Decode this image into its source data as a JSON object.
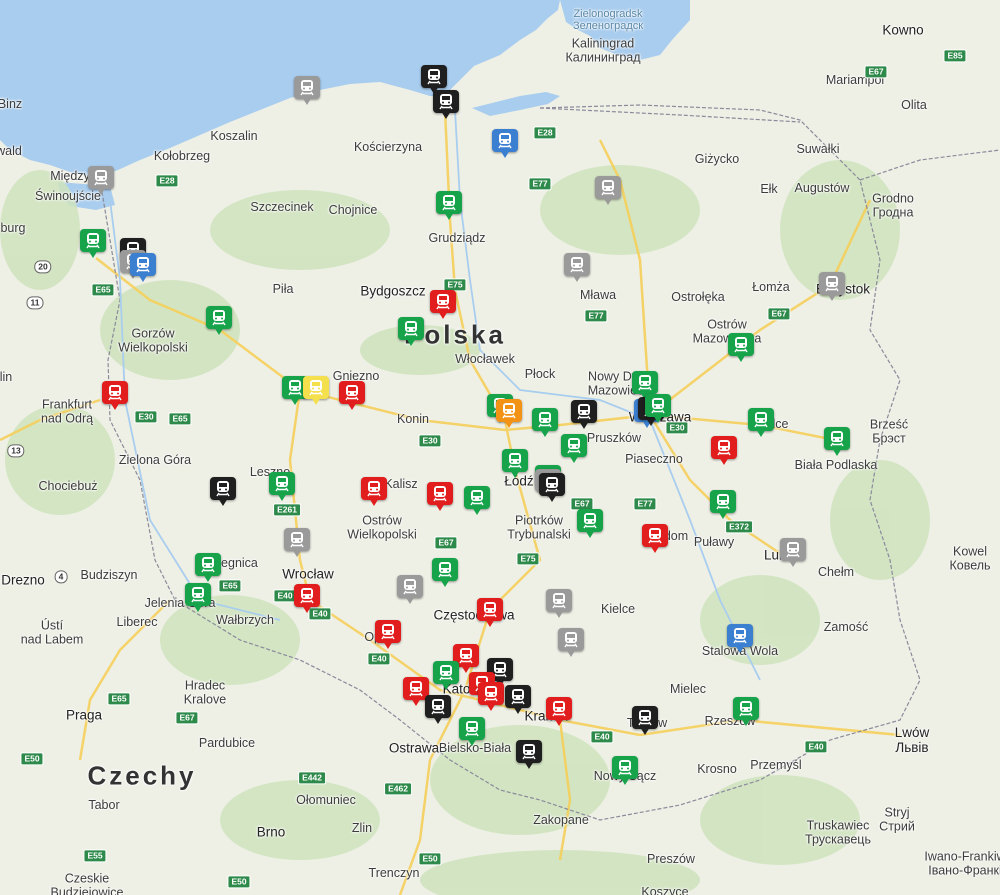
{
  "map": {
    "colors": {
      "land": "#eef0e6",
      "water": "#a9cdee",
      "green": "#cfe3bd",
      "forest": "#bcd9a3",
      "road_major": "#f6cf5a",
      "border": "#8a8a9a"
    },
    "labels": [
      {
        "id": "bornholm-strip",
        "text": "Binz",
        "cls": "city"
      },
      {
        "id": "kowno",
        "text": "Kowno",
        "cls": "big"
      },
      {
        "id": "zelenogradsk",
        "text": "Zielonogradsk\nЗеленоградск",
        "cls": "sea"
      },
      {
        "id": "kaliningrad",
        "text": "Kaliningrad\nКалининград",
        "cls": "city"
      },
      {
        "id": "marijampol",
        "text": "Mariampol",
        "cls": "city"
      },
      {
        "id": "olita",
        "text": "Olita",
        "cls": "city"
      },
      {
        "id": "koszalin",
        "text": "Koszalin",
        "cls": "city"
      },
      {
        "id": "kolobrzeg",
        "text": "Kołobrzeg",
        "cls": "city"
      },
      {
        "id": "koscierzyna",
        "text": "Kościerzyna",
        "cls": "city"
      },
      {
        "id": "gizycko",
        "text": "Giżycko",
        "cls": "city"
      },
      {
        "id": "suwalki",
        "text": "Suwałki",
        "cls": "city"
      },
      {
        "id": "augustow",
        "text": "Augustów",
        "cls": "city"
      },
      {
        "id": "elk",
        "text": "Ełk",
        "cls": "city"
      },
      {
        "id": "grodno",
        "text": "Grodno\nГродна",
        "cls": "city"
      },
      {
        "id": "szczecinek",
        "text": "Szczecinek",
        "cls": "city"
      },
      {
        "id": "chojnice",
        "text": "Chojnice",
        "cls": "city"
      },
      {
        "id": "grudziadz",
        "text": "Grudziądz",
        "cls": "city"
      },
      {
        "id": "wald",
        "text": "wald",
        "cls": "city"
      },
      {
        "id": "burg",
        "text": "burg",
        "cls": "city"
      },
      {
        "id": "swinoujscie",
        "text": "Świnoujście",
        "cls": "city"
      },
      {
        "id": "miedzy",
        "text": "Między",
        "cls": "city"
      },
      {
        "id": "pila",
        "text": "Piła",
        "cls": "city"
      },
      {
        "id": "bydgoszcz",
        "text": "Bydgoszcz",
        "cls": "big"
      },
      {
        "id": "mlawa",
        "text": "Mława",
        "cls": "city"
      },
      {
        "id": "ostroleka",
        "text": "Ostrołęka",
        "cls": "city"
      },
      {
        "id": "lomza",
        "text": "Łomża",
        "cls": "city"
      },
      {
        "id": "bialystok",
        "text": "Białystok",
        "cls": "big"
      },
      {
        "id": "polska",
        "text": "Polska",
        "cls": "country"
      },
      {
        "id": "gorzow",
        "text": "Gorzów\nWielkopolski",
        "cls": "city"
      },
      {
        "id": "wloclawek",
        "text": "Włocławek",
        "cls": "city"
      },
      {
        "id": "ostrow-maz",
        "text": "Ostrów\nMazowiecka",
        "cls": "city"
      },
      {
        "id": "lin",
        "text": "lin",
        "cls": "city"
      },
      {
        "id": "gniezno",
        "text": "Gniezno",
        "cls": "city"
      },
      {
        "id": "plock",
        "text": "Płock",
        "cls": "city"
      },
      {
        "id": "nowy-dwor",
        "text": "Nowy Dwór\nMazowiecki",
        "cls": "city"
      },
      {
        "id": "frankfurt",
        "text": "Frankfurt\nnad Odrą",
        "cls": "city"
      },
      {
        "id": "konin",
        "text": "Konin",
        "cls": "city"
      },
      {
        "id": "warszawa",
        "text": "Warszawa",
        "cls": "big"
      },
      {
        "id": "brzesc",
        "text": "Brześć\nБрэст",
        "cls": "city"
      },
      {
        "id": "pruszkow",
        "text": "Pruszków",
        "cls": "city"
      },
      {
        "id": "siedlce",
        "text": "Siedlce",
        "cls": "city"
      },
      {
        "id": "piaseczno",
        "text": "Piaseczno",
        "cls": "city"
      },
      {
        "id": "biala-podlaska",
        "text": "Biała Podlaska",
        "cls": "city"
      },
      {
        "id": "zielona-gora",
        "text": "Zielona Góra",
        "cls": "city"
      },
      {
        "id": "lodz",
        "text": "Łódź",
        "cls": "big"
      },
      {
        "id": "leszno",
        "text": "Leszno",
        "cls": "city"
      },
      {
        "id": "chociebuz",
        "text": "Chociebuż",
        "cls": "city"
      },
      {
        "id": "kalisz",
        "text": "Kalisz",
        "cls": "city"
      },
      {
        "id": "ostrow-wlkp",
        "text": "Ostrów\nWielkopolski",
        "cls": "city"
      },
      {
        "id": "piotrkow",
        "text": "Piotrków\nTrybunalski",
        "cls": "city"
      },
      {
        "id": "radom",
        "text": "Radom",
        "cls": "city"
      },
      {
        "id": "pulawy",
        "text": "Puławy",
        "cls": "city"
      },
      {
        "id": "lublin",
        "text": "Lublin",
        "cls": "big"
      },
      {
        "id": "kowel",
        "text": "Kowel\nКовель",
        "cls": "city"
      },
      {
        "id": "drezno",
        "text": "Drezno",
        "cls": "big"
      },
      {
        "id": "budziszyn",
        "text": "Budziszyn",
        "cls": "city"
      },
      {
        "id": "legnica",
        "text": "Legnica",
        "cls": "city"
      },
      {
        "id": "wroclaw",
        "text": "Wrocław",
        "cls": "big"
      },
      {
        "id": "chelm",
        "text": "Chełm",
        "cls": "city"
      },
      {
        "id": "jelenia",
        "text": "Jelenia Góra",
        "cls": "city"
      },
      {
        "id": "usti",
        "text": "Ústí\nnad Labem",
        "cls": "city"
      },
      {
        "id": "liberec",
        "text": "Liberec",
        "cls": "city"
      },
      {
        "id": "walbrzych",
        "text": "Wałbrzych",
        "cls": "city"
      },
      {
        "id": "opole",
        "text": "Opole",
        "cls": "city"
      },
      {
        "id": "czestochowa",
        "text": "Częstochowa",
        "cls": "big"
      },
      {
        "id": "kielce",
        "text": "Kielce",
        "cls": "city"
      },
      {
        "id": "zamosc",
        "text": "Zamość",
        "cls": "city"
      },
      {
        "id": "stalowa",
        "text": "Stalowa Wola",
        "cls": "city"
      },
      {
        "id": "hradec",
        "text": "Hradec\nKralove",
        "cls": "city"
      },
      {
        "id": "katowice",
        "text": "Katowice",
        "cls": "big"
      },
      {
        "id": "mielec",
        "text": "Mielec",
        "cls": "city"
      },
      {
        "id": "praga",
        "text": "Praga",
        "cls": "big"
      },
      {
        "id": "krakow",
        "text": "Kraków",
        "cls": "big"
      },
      {
        "id": "tarnow",
        "text": "Tarnów",
        "cls": "city"
      },
      {
        "id": "rzeszow",
        "text": "Rzeszów",
        "cls": "city"
      },
      {
        "id": "pardubice",
        "text": "Pardubice",
        "cls": "city"
      },
      {
        "id": "ostrawa",
        "text": "Ostrawa",
        "cls": "big"
      },
      {
        "id": "bielsko",
        "text": "Bielsko-Biała",
        "cls": "city"
      },
      {
        "id": "lwow",
        "text": "Lwów\nЛьвів",
        "cls": "big"
      },
      {
        "id": "czechy",
        "text": "Czechy",
        "cls": "country"
      },
      {
        "id": "krosno",
        "text": "Krosno",
        "cls": "city"
      },
      {
        "id": "przemysl",
        "text": "Przemyśl",
        "cls": "city"
      },
      {
        "id": "nowy-sacz",
        "text": "Nowy Sącz",
        "cls": "city"
      },
      {
        "id": "olomuniec",
        "text": "Ołomuniec",
        "cls": "city"
      },
      {
        "id": "tabor",
        "text": "Tabor",
        "cls": "city"
      },
      {
        "id": "brno",
        "text": "Brno",
        "cls": "big"
      },
      {
        "id": "zlin",
        "text": "Zlin",
        "cls": "city"
      },
      {
        "id": "zakopane",
        "text": "Zakopane",
        "cls": "city"
      },
      {
        "id": "stryj",
        "text": "Stryj\nСтрий",
        "cls": "city"
      },
      {
        "id": "truskawiec",
        "text": "Truskawiec\nТрускавець",
        "cls": "city"
      },
      {
        "id": "preszow",
        "text": "Preszów",
        "cls": "city"
      },
      {
        "id": "trenczyn",
        "text": "Trenczyn",
        "cls": "city"
      },
      {
        "id": "ivano",
        "text": "Iwano-Frankiw\nІвано-Франкі",
        "cls": "city"
      },
      {
        "id": "czeskie",
        "text": "Czeskie\nBudziejowice",
        "cls": "city"
      },
      {
        "id": "koszyce",
        "text": "Koszyce",
        "cls": "city"
      }
    ],
    "road_shields": [
      {
        "id": "e28-w",
        "text": "E28",
        "type": "eu"
      },
      {
        "id": "e28-e",
        "text": "E28",
        "type": "eu"
      },
      {
        "id": "e77-n",
        "text": "E77",
        "type": "eu"
      },
      {
        "id": "e85",
        "text": "E85",
        "type": "eu"
      },
      {
        "id": "e67-ne",
        "text": "E67",
        "type": "eu"
      },
      {
        "id": "r20",
        "text": "20",
        "type": "nat"
      },
      {
        "id": "e65-n",
        "text": "E65",
        "type": "eu"
      },
      {
        "id": "r11",
        "text": "11",
        "type": "nat"
      },
      {
        "id": "e75-n",
        "text": "E75",
        "type": "eu"
      },
      {
        "id": "e77-m",
        "text": "E77",
        "type": "eu"
      },
      {
        "id": "e67-m",
        "text": "E67",
        "type": "eu"
      },
      {
        "id": "e30-w",
        "text": "E30",
        "type": "eu"
      },
      {
        "id": "e65-m",
        "text": "E65",
        "type": "eu"
      },
      {
        "id": "e30-m",
        "text": "E30",
        "type": "eu"
      },
      {
        "id": "e30-e",
        "text": "E30",
        "type": "eu"
      },
      {
        "id": "r13",
        "text": "13",
        "type": "nat"
      },
      {
        "id": "e261",
        "text": "E261",
        "type": "eu"
      },
      {
        "id": "e67-c",
        "text": "E67",
        "type": "eu"
      },
      {
        "id": "e67-c2",
        "text": "E67",
        "type": "eu"
      },
      {
        "id": "e77-s",
        "text": "E77",
        "type": "eu"
      },
      {
        "id": "e372",
        "text": "E372",
        "type": "eu"
      },
      {
        "id": "r4",
        "text": "4",
        "type": "nat"
      },
      {
        "id": "e75-s",
        "text": "E75",
        "type": "eu"
      },
      {
        "id": "e65-s",
        "text": "E65",
        "type": "eu"
      },
      {
        "id": "e40-w",
        "text": "E40",
        "type": "eu"
      },
      {
        "id": "e40-m",
        "text": "E40",
        "type": "eu"
      },
      {
        "id": "e40-s",
        "text": "E40",
        "type": "eu"
      },
      {
        "id": "e40-e",
        "text": "E40",
        "type": "eu"
      },
      {
        "id": "e40-ee",
        "text": "E40",
        "type": "eu"
      },
      {
        "id": "e65-cz",
        "text": "E65",
        "type": "eu"
      },
      {
        "id": "e67-cz",
        "text": "E67",
        "type": "eu"
      },
      {
        "id": "e442",
        "text": "E442",
        "type": "eu"
      },
      {
        "id": "e462",
        "text": "E462",
        "type": "eu"
      },
      {
        "id": "e50",
        "text": "E50",
        "type": "eu"
      },
      {
        "id": "e50-b",
        "text": "E50",
        "type": "eu"
      },
      {
        "id": "e55",
        "text": "E55",
        "type": "eu"
      },
      {
        "id": "e50-c",
        "text": "E50",
        "type": "eu"
      }
    ],
    "markers": [
      {
        "id": "slupsk",
        "status": "gray"
      },
      {
        "id": "gdynia",
        "status": "black"
      },
      {
        "id": "gdansk",
        "status": "black"
      },
      {
        "id": "elblag",
        "status": "blue"
      },
      {
        "id": "swinoujscie-m",
        "status": "gray"
      },
      {
        "id": "olsztyn",
        "status": "gray"
      },
      {
        "id": "tczew",
        "status": "green"
      },
      {
        "id": "szczecin-1",
        "status": "green"
      },
      {
        "id": "szczecin-2",
        "status": "black"
      },
      {
        "id": "szczecin-3",
        "status": "gray"
      },
      {
        "id": "szczecin-4",
        "status": "blue"
      },
      {
        "id": "ilawa",
        "status": "gray"
      },
      {
        "id": "bialystok-m",
        "status": "gray"
      },
      {
        "id": "bydgoszcz-m",
        "status": "red"
      },
      {
        "id": "torun",
        "status": "green"
      },
      {
        "id": "krzyz",
        "status": "green"
      },
      {
        "id": "ostrow-maz-m",
        "status": "green"
      },
      {
        "id": "rzepin",
        "status": "red"
      },
      {
        "id": "poznan-1",
        "status": "green"
      },
      {
        "id": "poznan-2",
        "status": "yellow"
      },
      {
        "id": "poznan-3",
        "status": "red"
      },
      {
        "id": "wwa-1",
        "status": "green"
      },
      {
        "id": "wwa-2",
        "status": "blue"
      },
      {
        "id": "wwa-3",
        "status": "black"
      },
      {
        "id": "wwa-4",
        "status": "green"
      },
      {
        "id": "kutno-1",
        "status": "green"
      },
      {
        "id": "kutno-2",
        "status": "orange"
      },
      {
        "id": "lowicz",
        "status": "green"
      },
      {
        "id": "skierniewice",
        "status": "black"
      },
      {
        "id": "siedlce-m",
        "status": "green"
      },
      {
        "id": "biala-m",
        "status": "green"
      },
      {
        "id": "zyrardow",
        "status": "green"
      },
      {
        "id": "pilawa",
        "status": "red"
      },
      {
        "id": "zgierz",
        "status": "green"
      },
      {
        "id": "lodz-1",
        "status": "green"
      },
      {
        "id": "lodz-2",
        "status": "gray"
      },
      {
        "id": "lodz-3",
        "status": "black"
      },
      {
        "id": "zbaszynek",
        "status": "black"
      },
      {
        "id": "leszno-m",
        "status": "green"
      },
      {
        "id": "kalisz-m",
        "status": "red"
      },
      {
        "id": "sieradz",
        "status": "red"
      },
      {
        "id": "zdunska",
        "status": "green"
      },
      {
        "id": "deblin",
        "status": "green"
      },
      {
        "id": "tomaszow",
        "status": "green"
      },
      {
        "id": "radom-m",
        "status": "red"
      },
      {
        "id": "lublin-m",
        "status": "gray"
      },
      {
        "id": "olesnica",
        "status": "gray"
      },
      {
        "id": "legnica-m",
        "status": "green"
      },
      {
        "id": "wielun",
        "status": "green"
      },
      {
        "id": "jelenia-m",
        "status": "green"
      },
      {
        "id": "wroclaw-m",
        "status": "red"
      },
      {
        "id": "kluczbork",
        "status": "gray"
      },
      {
        "id": "czestochowa-m",
        "status": "red"
      },
      {
        "id": "konskie",
        "status": "gray"
      },
      {
        "id": "opole-m",
        "status": "red"
      },
      {
        "id": "kielce-m",
        "status": "gray"
      },
      {
        "id": "stalowa-m",
        "status": "blue"
      },
      {
        "id": "lubliniec",
        "status": "red"
      },
      {
        "id": "gliwice",
        "status": "green"
      },
      {
        "id": "kat-1",
        "status": "black"
      },
      {
        "id": "kat-2",
        "status": "red"
      },
      {
        "id": "kat-3",
        "status": "red"
      },
      {
        "id": "rybnik",
        "status": "red"
      },
      {
        "id": "sosnowiec",
        "status": "black"
      },
      {
        "id": "krakow-m",
        "status": "red"
      },
      {
        "id": "pszczyna",
        "status": "black"
      },
      {
        "id": "rzeszow-m",
        "status": "green"
      },
      {
        "id": "tarnow-m",
        "status": "black"
      },
      {
        "id": "czechowice",
        "status": "green"
      },
      {
        "id": "sucha",
        "status": "black"
      },
      {
        "id": "nowy-sacz-m",
        "status": "green"
      }
    ],
    "status_colors": {
      "green": "#16a34a",
      "red": "#e11d1d",
      "gray": "#9a9a9a",
      "black": "#1f1f1f",
      "blue": "#3b7fd0",
      "yellow": "#f4e04d",
      "orange": "#f39316"
    }
  }
}
